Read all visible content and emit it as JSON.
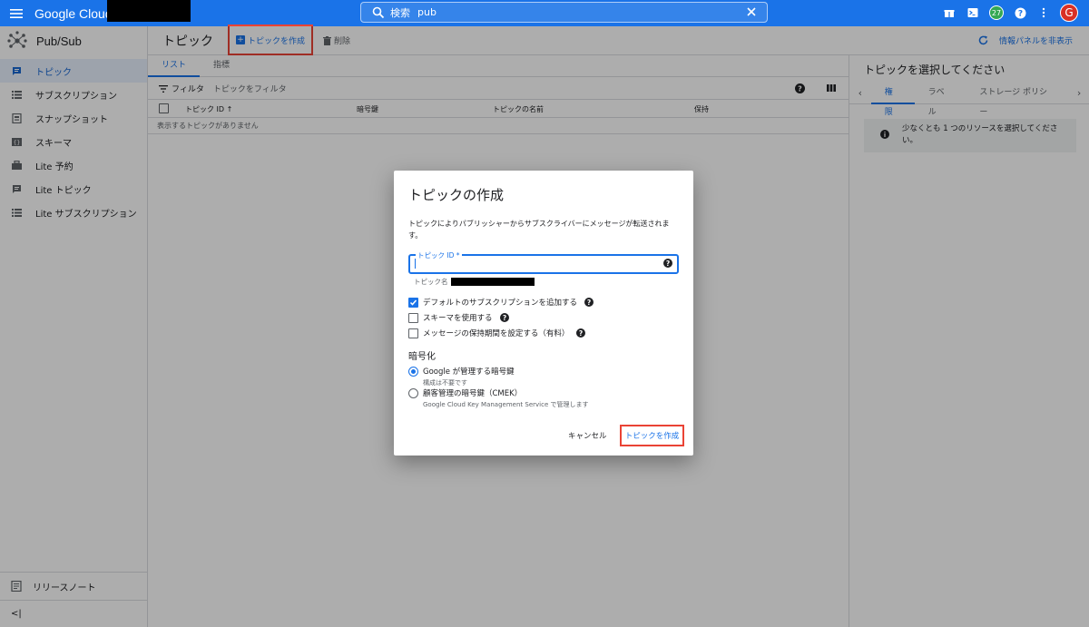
{
  "topbar": {
    "logo": "Google Cloud",
    "search_label": "検索",
    "search_value": "pub",
    "notification_count": "27",
    "avatar_initial": "G",
    "color": "#1a73e8"
  },
  "leftnav": {
    "product": "Pub/Sub",
    "items": [
      {
        "label": "トピック",
        "icon": "topic-icon",
        "active": true
      },
      {
        "label": "サブスクリプション",
        "icon": "list-icon"
      },
      {
        "label": "スナップショット",
        "icon": "snapshot-icon"
      },
      {
        "label": "スキーマ",
        "icon": "schema-icon"
      },
      {
        "label": "Lite 予約",
        "icon": "reservation-icon"
      },
      {
        "label": "Lite トピック",
        "icon": "topic-icon"
      },
      {
        "label": "Lite サブスクリプション",
        "icon": "list-icon"
      }
    ],
    "release_notes": "リリースノート",
    "collapse": "<|"
  },
  "header": {
    "title": "トピック",
    "create_label": "トピックを作成",
    "delete_label": "削除",
    "hide_panel_label": "情報パネルを非表示"
  },
  "tabs": [
    "リスト",
    "指標"
  ],
  "filter": {
    "label": "フィルタ",
    "placeholder": "トピックをフィルタ"
  },
  "table": {
    "columns": [
      "トピック ID",
      "暗号鍵",
      "トピックの名前",
      "保持"
    ],
    "empty_text": "表示するトピックがありません"
  },
  "rightpanel": {
    "title": "トピックを選択してください",
    "tabs": [
      "権限",
      "ラベル",
      "ストレージ ポリシー"
    ],
    "info": "少なくとも 1 つのリソースを選択してください。"
  },
  "dialog": {
    "title": "トピックの作成",
    "description": "トピックによりパブリッシャーからサブスクライバーにメッセージが転送されます。",
    "field_label": "トピック ID",
    "field_required": "*",
    "field_value": "",
    "topic_name_label": "トピック名",
    "checkboxes": [
      {
        "label": "デフォルトのサブスクリプションを追加する",
        "checked": true
      },
      {
        "label": "スキーマを使用する",
        "checked": false
      },
      {
        "label": "メッセージの保持期間を設定する（有料）",
        "checked": false
      }
    ],
    "encryption_title": "暗号化",
    "radios": [
      {
        "label": "Google が管理する暗号鍵",
        "sub": "構成は不要です",
        "selected": true
      },
      {
        "label": "顧客管理の暗号鍵（CMEK）",
        "sub": "Google Cloud Key Management Service で管理します",
        "selected": false
      }
    ],
    "cancel_label": "キャンセル",
    "confirm_label": "トピックを作成"
  }
}
